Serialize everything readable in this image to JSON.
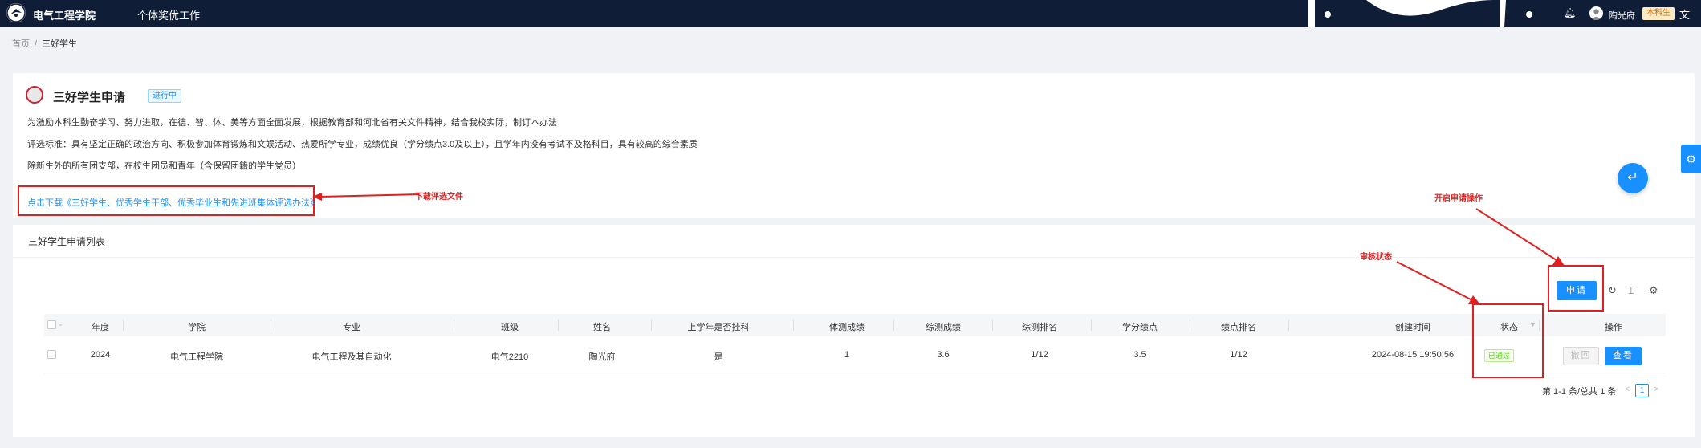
{
  "topbar": {
    "brand": "电气工程学院",
    "menu_item": "个体奖优工作",
    "username": "陶光府",
    "role_badge": "本科生",
    "lang_icon": "文"
  },
  "breadcrumb": {
    "home": "首页",
    "separator": "/",
    "current": "三好学生"
  },
  "info": {
    "title": "三好学生申请",
    "status": "进行中",
    "desc1": "为激励本科生勤奋学习、努力进取，在德、智、体、美等方面全面发展，根据教育部和河北省有关文件精神，结合我校实际，制订本办法",
    "desc2": "评选标准：具有坚定正确的政治方向、积极参加体育锻炼和文娱活动、热爱所学专业，成绩优良（学分绩点3.0及以上），且学年内没有考试不及格科目，具有较高的综合素质",
    "desc3": "除新生外的所有团支部，在校生团员和青年（含保留团籍的学生党员）",
    "download_link": "点击下载《三好学生、优秀学生干部、优秀毕业生和先进班集体评选办法》"
  },
  "annotations": {
    "download": "下载评选文件",
    "apply": "开启申请操作",
    "status": "审核状态"
  },
  "list": {
    "title": "三好学生申请列表",
    "apply_button": "申请",
    "columns": [
      "年度",
      "学院",
      "专业",
      "班级",
      "姓名",
      "上学年是否挂科",
      "体测成绩",
      "综测成绩",
      "综测排名",
      "学分绩点",
      "绩点排名",
      "创建时间",
      "状态",
      "操作"
    ],
    "rows": [
      {
        "year": "2024",
        "college": "电气工程学院",
        "major": "电气工程及其自动化",
        "class": "电气2210",
        "name": "陶光府",
        "failed": "是",
        "pe_score": "1",
        "comp_score": "3.6",
        "comp_rank": "1/12",
        "gpa": "3.5",
        "gpa_rank": "1/12",
        "created": "2024-08-15 19:50:56",
        "status": "已通过",
        "revoke": "撤回",
        "view": "查看"
      }
    ],
    "pager_text": "第 1-1 条/总共 1 条",
    "page": "1"
  },
  "colors": {
    "topbar": "#0f1d36",
    "primary": "#1890ff",
    "annotation": "#e02020",
    "success": "#52c41a"
  },
  "icons": [
    "college-logo-icon",
    "bell-icon",
    "translate-icon",
    "float-action-icon",
    "settings-icon",
    "refresh-icon",
    "column-height-icon",
    "filter-icon"
  ]
}
